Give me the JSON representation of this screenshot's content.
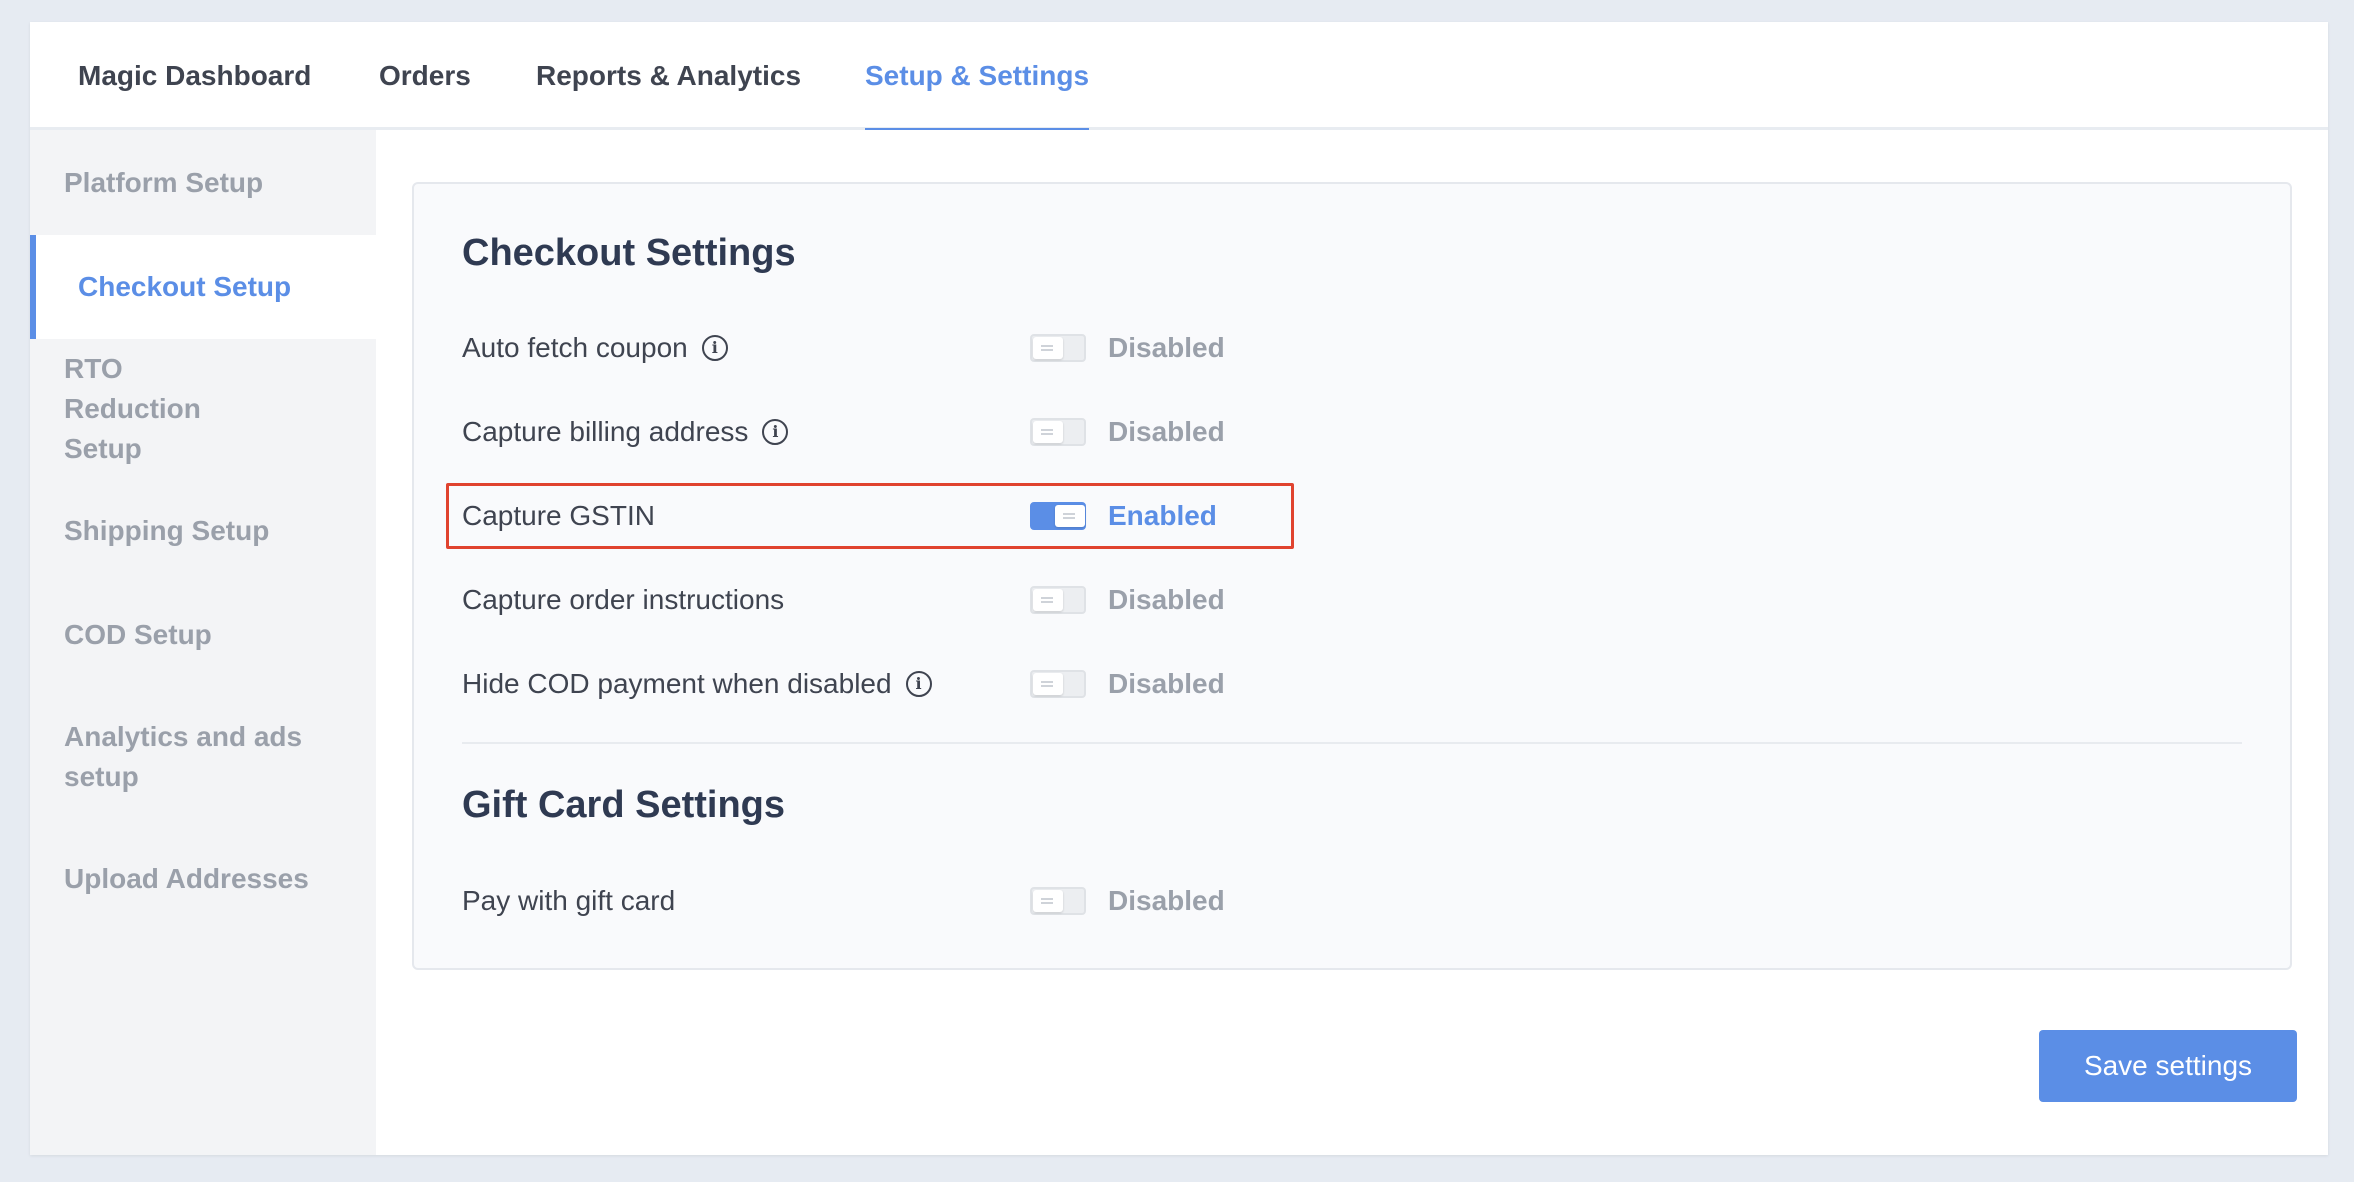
{
  "topnav": {
    "tabs": [
      {
        "label": "Magic Dashboard"
      },
      {
        "label": "Orders"
      },
      {
        "label": "Reports & Analytics"
      },
      {
        "label": "Setup & Settings",
        "active": true
      }
    ]
  },
  "sidebar": {
    "items": [
      {
        "label": "Platform Setup"
      },
      {
        "label": "Checkout Setup",
        "active": true
      },
      {
        "label": "RTO Reduction Setup"
      },
      {
        "label": "Shipping Setup"
      },
      {
        "label": "COD Setup"
      },
      {
        "label": "Analytics and ads setup"
      },
      {
        "label": "Upload Addresses"
      }
    ]
  },
  "checkout": {
    "title": "Checkout Settings",
    "rows": [
      {
        "label": "Auto fetch coupon",
        "info": true,
        "enabled": false,
        "state": "Disabled"
      },
      {
        "label": "Capture billing address",
        "info": true,
        "enabled": false,
        "state": "Disabled"
      },
      {
        "label": "Capture GSTIN",
        "info": false,
        "enabled": true,
        "state": "Enabled",
        "highlighted": true
      },
      {
        "label": "Capture order instructions",
        "info": false,
        "enabled": false,
        "state": "Disabled"
      },
      {
        "label": "Hide COD payment when disabled",
        "info": true,
        "enabled": false,
        "state": "Disabled"
      }
    ]
  },
  "giftcard": {
    "title": "Gift Card Settings",
    "rows": [
      {
        "label": "Pay with gift card",
        "info": false,
        "enabled": false,
        "state": "Disabled"
      }
    ]
  },
  "actions": {
    "save_label": "Save settings"
  },
  "icons": {
    "info": "info-circle-icon"
  },
  "colors": {
    "accent": "#5b8ee6",
    "highlight_border": "#e0432f",
    "muted_text": "#9aa0aa"
  }
}
